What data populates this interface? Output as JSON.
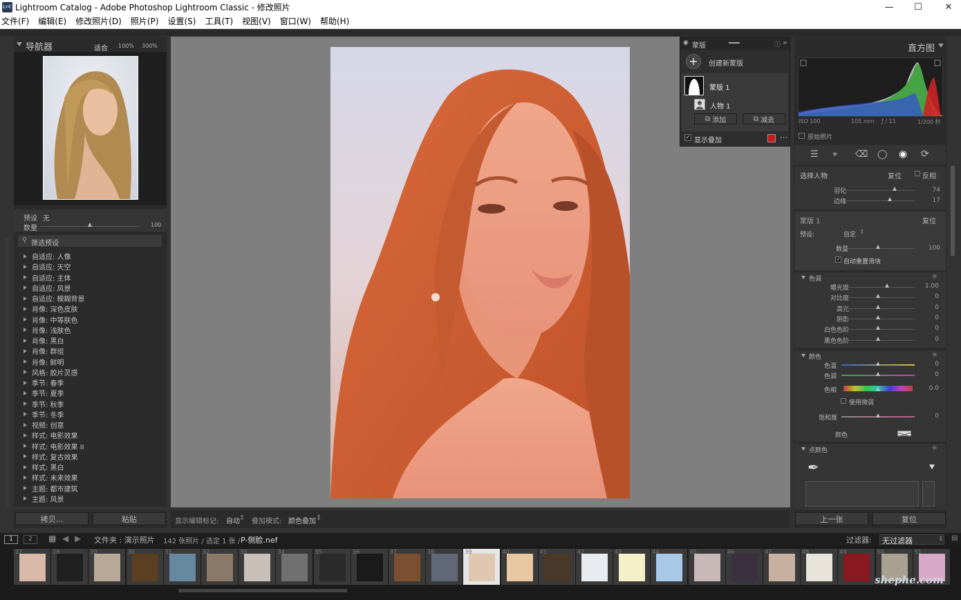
{
  "window": {
    "title": "Lightroom Catalog - Adobe Photoshop Lightroom Classic - 修改照片",
    "app_icon": "LrC"
  },
  "menu": [
    "文件(F)",
    "编辑(E)",
    "修改照片(D)",
    "照片(P)",
    "设置(S)",
    "工具(T)",
    "视图(V)",
    "窗口(W)",
    "帮助(H)"
  ],
  "navigator": {
    "title": "导航器",
    "zoom_fit": "适合",
    "zoom_100": "100%",
    "zoom_300": "300%"
  },
  "presets_panel": {
    "preset_label": "预设",
    "preset_value": "无",
    "amount_label": "数量",
    "amount_value": "100",
    "filter_placeholder": "筛选预设"
  },
  "presets": [
    "自适应: 人像",
    "自适应: 天空",
    "自适应: 主体",
    "自适应: 风景",
    "自适应: 模糊背景",
    "肖像: 深色皮肤",
    "肖像: 中等肤色",
    "肖像: 浅肤色",
    "肖像: 黑白",
    "肖像: 群组",
    "肖像: 鲜明",
    "风格: 胶片灵感",
    "季节: 春季",
    "季节: 夏季",
    "季节: 秋季",
    "季节: 冬季",
    "视频: 创意",
    "样式: 电影效果",
    "样式: 电影效果 II",
    "样式: 复古效果",
    "样式: 黑白",
    "样式: 未来效果",
    "主题: 都市建筑",
    "主题: 风景"
  ],
  "left_buttons": {
    "copy": "拷贝...",
    "paste": "粘贴"
  },
  "mask_panel": {
    "title": "蒙版",
    "create": "创建新蒙版",
    "mask1": "蒙版 1",
    "person1": "人物 1",
    "add": "添加",
    "subtract": "减去",
    "overlay": "显示叠加",
    "overlay_color": "#cc1a1a"
  },
  "histogram": {
    "title": "直方图",
    "iso": "ISO 100",
    "focal": "105 mm",
    "aperture": "ƒ / 11",
    "shutter": "1/200 秒",
    "original": "原始照片"
  },
  "select_person": {
    "label": "选择人物",
    "reset": "复位",
    "invert": "反相",
    "feather_label": "羽化",
    "feather_value": "74",
    "edge_label": "边缘",
    "edge_value": "17"
  },
  "mask_settings": {
    "title": "蒙版 1",
    "reset": "复位",
    "preset_label": "预设:",
    "preset_value": "自定",
    "amount_label": "数量",
    "amount_value": "100",
    "auto_reset": "自动重置滑块"
  },
  "tone": {
    "title": "色调",
    "items": [
      {
        "label": "曝光度",
        "value": "1.00",
        "pos": 0.62
      },
      {
        "label": "对比度",
        "value": "0",
        "pos": 0.5
      },
      {
        "label": "高光",
        "value": "0",
        "pos": 0.5
      },
      {
        "label": "阴影",
        "value": "0",
        "pos": 0.5
      },
      {
        "label": "白色色阶",
        "value": "0",
        "pos": 0.5
      },
      {
        "label": "黑色色阶",
        "value": "0",
        "pos": 0.5
      }
    ]
  },
  "color": {
    "title": "颜色",
    "temp_label": "色温",
    "temp_value": "0",
    "tint_label": "色调",
    "tint_value": "0",
    "hue_label": "色相",
    "hue_value": "0.0",
    "fine_tune": "使用微调",
    "sat_label": "饱和度",
    "sat_value": "0",
    "color_label": "颜色"
  },
  "point_color": {
    "title": "点颜色"
  },
  "right_buttons": {
    "prev": "上一张",
    "reset": "复位"
  },
  "toolbar": {
    "show_label": "显示编辑标记:",
    "show_value": "自动",
    "overlay_mode_label": "叠加模式:",
    "overlay_mode_value": "颜色叠加"
  },
  "filmstrip_bar": {
    "view1": "1",
    "view2": "2",
    "folder": "文件夹 : 演示照片",
    "count": "142 张照片 / 选定 1 张 /",
    "file": "P-侧脸.nef",
    "filter_label": "过滤器:",
    "filter_value": "无过滤器"
  },
  "film_numbers": [
    "27",
    "28",
    "29",
    "30",
    "31",
    "32",
    "33",
    "34",
    "35",
    "36",
    "37",
    "38",
    "39",
    "40",
    "41",
    "42",
    "43",
    "44",
    "45",
    "46",
    "47",
    "48",
    "49",
    "50",
    "51"
  ],
  "film_colors": [
    "#d8b8a8",
    "#202020",
    "#b8a898",
    "#5a4020",
    "#6888a0",
    "#8a7868",
    "#c8c0b8",
    "#707070",
    "#2a2a2a",
    "#1a1a1a",
    "#7a5030",
    "#606878",
    "#e0c8b0",
    "#e8c8a0",
    "#4a3828",
    "#e8ecf0",
    "#f4f0c8",
    "#a8c8e8",
    "#c8b8b8",
    "#3a3040",
    "#c8b0a0",
    "#e8e4dc",
    "#8a1820",
    "#a8a090",
    "#d8a8c8"
  ],
  "watermark": "shephe.com"
}
